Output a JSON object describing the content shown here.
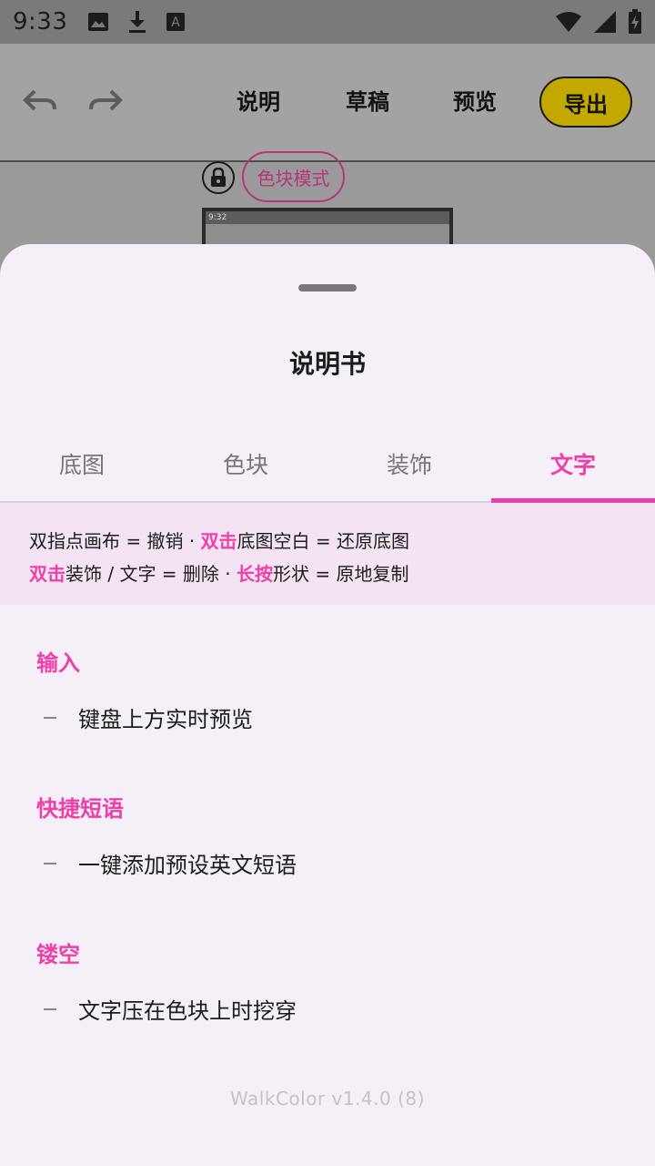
{
  "status_bar": {
    "time": "9:33",
    "icons_left": [
      "image-icon",
      "download-icon",
      "font-icon"
    ],
    "icons_right": [
      "wifi-icon",
      "signal-icon",
      "battery-charging-icon"
    ]
  },
  "toolbar": {
    "undo_icon": "undo-icon",
    "redo_icon": "redo-icon",
    "help_label": "说明",
    "draft_label": "草稿",
    "preview_label": "预览",
    "export_label": "导出"
  },
  "canvas": {
    "lock_icon": "lock-icon",
    "mode_label": "色块模式",
    "thumb_time": "9:32"
  },
  "sheet": {
    "title": "说明书",
    "tabs": [
      {
        "label": "底图",
        "active": false
      },
      {
        "label": "色块",
        "active": false
      },
      {
        "label": "装饰",
        "active": false
      },
      {
        "label": "文字",
        "active": true
      }
    ],
    "tips": {
      "line1_a": "双指点画布 = 撤销 · ",
      "line1_hl": "双击",
      "line1_b": "底图空白 = 还原底图",
      "line2_hl1": "双击",
      "line2_a": "装饰 / 文字 = 删除 · ",
      "line2_hl2": "长按",
      "line2_b": "形状 = 原地复制"
    },
    "sections": [
      {
        "heading": "输入",
        "item": "键盘上方实时预览"
      },
      {
        "heading": "快捷短语",
        "item": "一键添加预设英文短语"
      },
      {
        "heading": "镂空",
        "item": "文字压在色块上时挖穿"
      }
    ],
    "version": "WalkColor v1.4.0 (8)"
  },
  "colors": {
    "accent": "#ef3fa8",
    "export_button": "#c2a800",
    "sheet_bg": "#f5eff7",
    "tips_bg": "#f4e3f3"
  }
}
